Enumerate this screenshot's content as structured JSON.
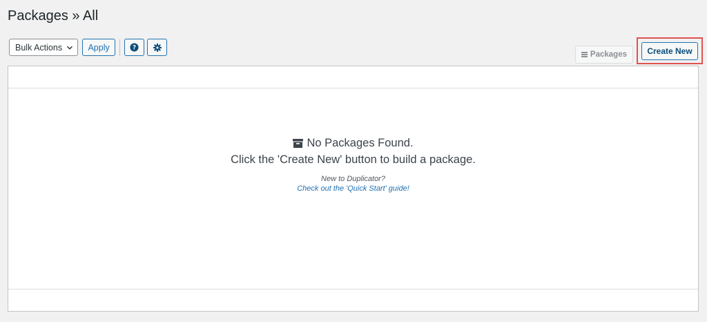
{
  "header": {
    "title": "Packages » All"
  },
  "toolbar": {
    "bulk_actions_label": "Bulk Actions",
    "apply_label": "Apply",
    "help_icon": "question-circle-icon",
    "settings_icon": "gear-icon"
  },
  "actions": {
    "packages_label": "Packages",
    "create_new_label": "Create New"
  },
  "empty_state": {
    "icon": "archive-box-icon",
    "heading": "No Packages Found.",
    "message": "Click the 'Create New' button to build a package.",
    "new_prompt": "New to Duplicator?",
    "guide_link": "Check out the 'Quick Start' guide!"
  },
  "colors": {
    "accent": "#2271b1",
    "highlight": "#e05252",
    "background": "#f1f1f1"
  }
}
